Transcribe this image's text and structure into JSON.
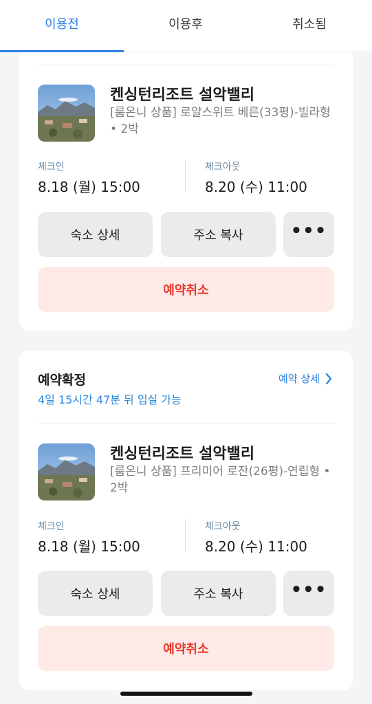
{
  "tabs": [
    {
      "label": "이용전"
    },
    {
      "label": "이용후"
    },
    {
      "label": "취소됨"
    }
  ],
  "colors": {
    "accent": "#2a7fe0",
    "cancel_text": "#e53b2b",
    "cancel_bg": "#fdeae7"
  },
  "bookings": [
    {
      "hotel_name": "켄싱턴리조트 설악밸리",
      "room_desc": "[룸온니 상품] 로얄스위트 베른(33평)-빌라형 • 2박",
      "checkin_label": "체크인",
      "checkin_value": "8.18 (월) 15:00",
      "checkout_label": "체크아웃",
      "checkout_value": "8.20 (수) 11:00",
      "detail_button": "숙소 상세",
      "copy_button": "주소 복사",
      "more_button": "•••",
      "cancel_button": "예약취소"
    },
    {
      "status": "예약확정",
      "eta": "4일 15시간 47분 뒤 입실 가능",
      "detail_link": "예약 상세",
      "hotel_name": "켄싱턴리조트 설악밸리",
      "room_desc": "[룸온니 상품] 프리미어 로잔(26평)-연립형 • 2박",
      "checkin_label": "체크인",
      "checkin_value": "8.18 (월) 15:00",
      "checkout_label": "체크아웃",
      "checkout_value": "8.20 (수) 11:00",
      "detail_button": "숙소 상세",
      "copy_button": "주소 복사",
      "more_button": "•••",
      "cancel_button": "예약취소"
    }
  ]
}
